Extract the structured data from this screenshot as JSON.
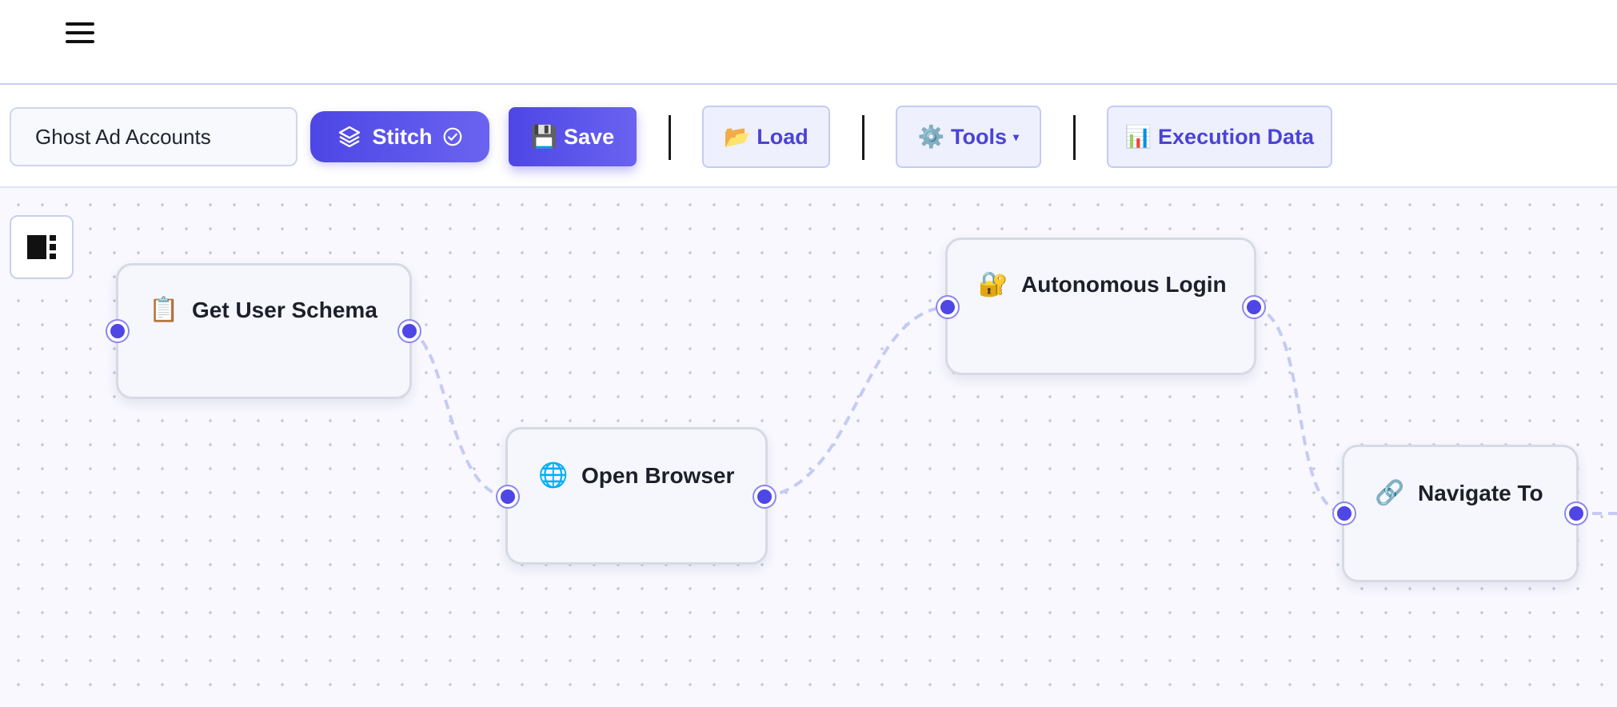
{
  "header": {
    "menu_icon": "hamburger-menu-icon"
  },
  "toolbar": {
    "workflow_name": "Ghost Ad Accounts",
    "stitch_label": "Stitch",
    "stitch_icon": "layers-icon",
    "stitch_status_icon": "check-circle-icon",
    "save_label": "💾 Save",
    "load_label": "📂 Load",
    "tools_label": "⚙️ Tools",
    "tools_caret": "▾",
    "execution_data_label": "📊 Execution Data"
  },
  "canvas": {
    "panel_toggle_icon": "sidebar-panel-icon",
    "nodes": [
      {
        "id": "get-user-schema",
        "icon": "📋",
        "title": "Get User Schema"
      },
      {
        "id": "open-browser",
        "icon": "🌐",
        "title": "Open Browser"
      },
      {
        "id": "autonomous-login",
        "icon": "🔐",
        "title": "Autonomous Login"
      },
      {
        "id": "navigate-to",
        "icon": "🔗",
        "title": "Navigate To"
      }
    ]
  },
  "colors": {
    "accent": "#4e46e5",
    "edge": "#c5cbf3",
    "canvas_bg": "#f8f8fe",
    "light_button_bg": "#eef0fd",
    "light_button_text": "#4b43d6"
  }
}
